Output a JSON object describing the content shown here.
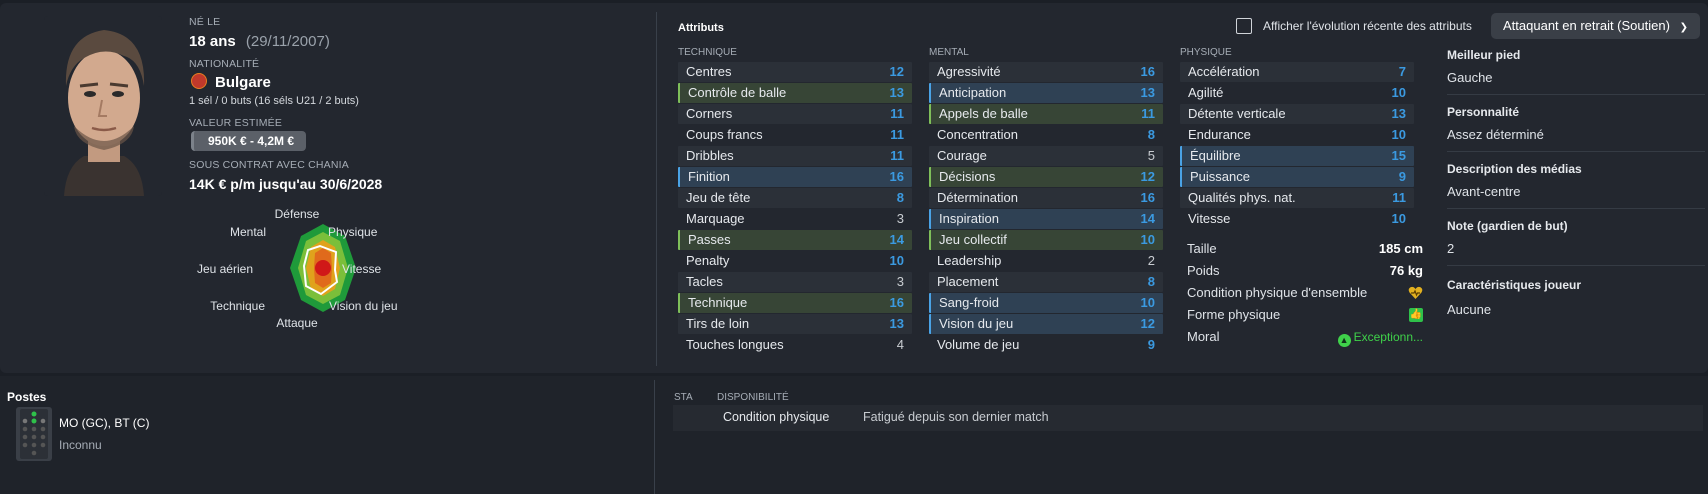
{
  "bio": {
    "born_label": "NÉ LE",
    "age": "18 ans",
    "birth_date": "(29/11/2007)",
    "nationality_label": "NATIONALITÉ",
    "nationality": "Bulgare",
    "caps": "1 sél / 0 buts (16 séls U21 / 2 buts)",
    "value_label": "VALEUR ESTIMÉE",
    "value": "950K € - 4,2M €",
    "contract_label": "SOUS CONTRAT AVEC CHANIA",
    "contract": "14K € p/m jusqu'au 30/6/2028"
  },
  "radar": {
    "labels": [
      "Défense",
      "Physique",
      "Vitesse",
      "Vision du jeu",
      "Attaque",
      "Technique",
      "Jeu aérien",
      "Mental"
    ]
  },
  "attributes_header": {
    "title": "Attributs",
    "checkbox_label": "Afficher l'évolution récente des attributs",
    "role_dropdown": "Attaquant en retrait (Soutien)",
    "role_chevron": "chevron-down-icon"
  },
  "technique": {
    "title": "TECHNIQUE",
    "rows": [
      {
        "name": "Centres",
        "value": "12"
      },
      {
        "name": "Contrôle de balle",
        "value": "13"
      },
      {
        "name": "Corners",
        "value": "11"
      },
      {
        "name": "Coups francs",
        "value": "11"
      },
      {
        "name": "Dribbles",
        "value": "11"
      },
      {
        "name": "Finition",
        "value": "16"
      },
      {
        "name": "Jeu de tête",
        "value": "8"
      },
      {
        "name": "Marquage",
        "value": "3"
      },
      {
        "name": "Passes",
        "value": "14"
      },
      {
        "name": "Penalty",
        "value": "10"
      },
      {
        "name": "Tacles",
        "value": "3"
      },
      {
        "name": "Technique",
        "value": "16"
      },
      {
        "name": "Tirs de loin",
        "value": "13"
      },
      {
        "name": "Touches longues",
        "value": "4"
      }
    ]
  },
  "mental": {
    "title": "MENTAL",
    "rows": [
      {
        "name": "Agressivité",
        "value": "16"
      },
      {
        "name": "Anticipation",
        "value": "13"
      },
      {
        "name": "Appels de balle",
        "value": "11"
      },
      {
        "name": "Concentration",
        "value": "8"
      },
      {
        "name": "Courage",
        "value": "5"
      },
      {
        "name": "Décisions",
        "value": "12"
      },
      {
        "name": "Détermination",
        "value": "16"
      },
      {
        "name": "Inspiration",
        "value": "14"
      },
      {
        "name": "Jeu collectif",
        "value": "10"
      },
      {
        "name": "Leadership",
        "value": "2"
      },
      {
        "name": "Placement",
        "value": "8"
      },
      {
        "name": "Sang-froid",
        "value": "10"
      },
      {
        "name": "Vision du jeu",
        "value": "12"
      },
      {
        "name": "Volume de jeu",
        "value": "9"
      }
    ]
  },
  "physique": {
    "title": "PHYSIQUE",
    "rows": [
      {
        "name": "Accélération",
        "value": "7"
      },
      {
        "name": "Agilité",
        "value": "10"
      },
      {
        "name": "Détente verticale",
        "value": "13"
      },
      {
        "name": "Endurance",
        "value": "10"
      },
      {
        "name": "Équilibre",
        "value": "15"
      },
      {
        "name": "Puissance",
        "value": "9"
      },
      {
        "name": "Qualités phys. nat.",
        "value": "11"
      },
      {
        "name": "Vitesse",
        "value": "10"
      }
    ],
    "height_label": "Taille",
    "height": "185 cm",
    "weight_label": "Poids",
    "weight": "76 kg",
    "condition_label": "Condition physique d'ensemble",
    "condition_icon": "heart-icon",
    "form_label": "Forme physique",
    "form_icon": "thumbs-up-icon",
    "morale_label": "Moral",
    "morale": "Exceptionn..."
  },
  "side_info": {
    "foot_label": "Meilleur pied",
    "foot": "Gauche",
    "personality_label": "Personnalité",
    "personality": "Assez déterminé",
    "media_label": "Description des médias",
    "media": "Avant-centre",
    "gk_label": "Note (gardien de but)",
    "gk": "2",
    "traits_label": "Caractéristiques joueur",
    "traits": "Aucune"
  },
  "positions": {
    "title": "Postes",
    "positions": "MO (GC), BT (C)",
    "secondary": "Inconnu"
  },
  "availability": {
    "sta_label": "STA",
    "dispo_label": "DISPONIBILITÉ",
    "row_label": "Condition physique",
    "row_value": "Fatigué depuis son dernier match"
  },
  "colors": {
    "accent_blue": "#3b9ae1",
    "highlight_green": "#7fbf5a",
    "morale_green": "#3fd14a"
  }
}
